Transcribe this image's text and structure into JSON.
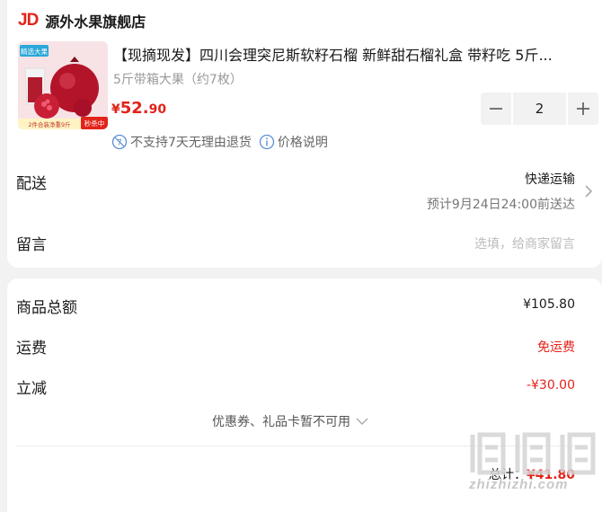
{
  "store": {
    "logo": "JD",
    "name": "源外水果旗舰店"
  },
  "product": {
    "title": "【现摘现发】四川会理突尼斯软籽石榴 新鲜甜石榴礼盒 带籽吃 5斤...",
    "spec": "5斤带箱大果（约7枚）",
    "price_symbol": "¥",
    "price_int": "52.",
    "price_dec": "90",
    "quantity": "2",
    "image_badge_top": "精选大果",
    "image_badge_bottom": "秒杀中",
    "image_badge_strip": "2件合装净重9斤"
  },
  "policies": {
    "no_return": "不支持7天无理由退货",
    "price_info": "价格说明"
  },
  "delivery": {
    "label": "配送",
    "method": "快递运输",
    "eta": "预计9月24日24:00前送达"
  },
  "note": {
    "label": "留言",
    "placeholder": "选填，给商家留言"
  },
  "summary": {
    "goods_label": "商品总额",
    "goods_value": "¥105.80",
    "freight_label": "运费",
    "freight_value": "免运费",
    "discount_label": "立减",
    "discount_value": "-¥30.00",
    "coupon_text": "优惠券、礼品卡暂不可用",
    "total_label": "总计：",
    "total_value": "¥41.80"
  },
  "watermark": {
    "text": "zhizhizhi.com"
  },
  "colors": {
    "accent": "#e2231a",
    "background": "#f2f2f2",
    "muted": "#999999"
  }
}
